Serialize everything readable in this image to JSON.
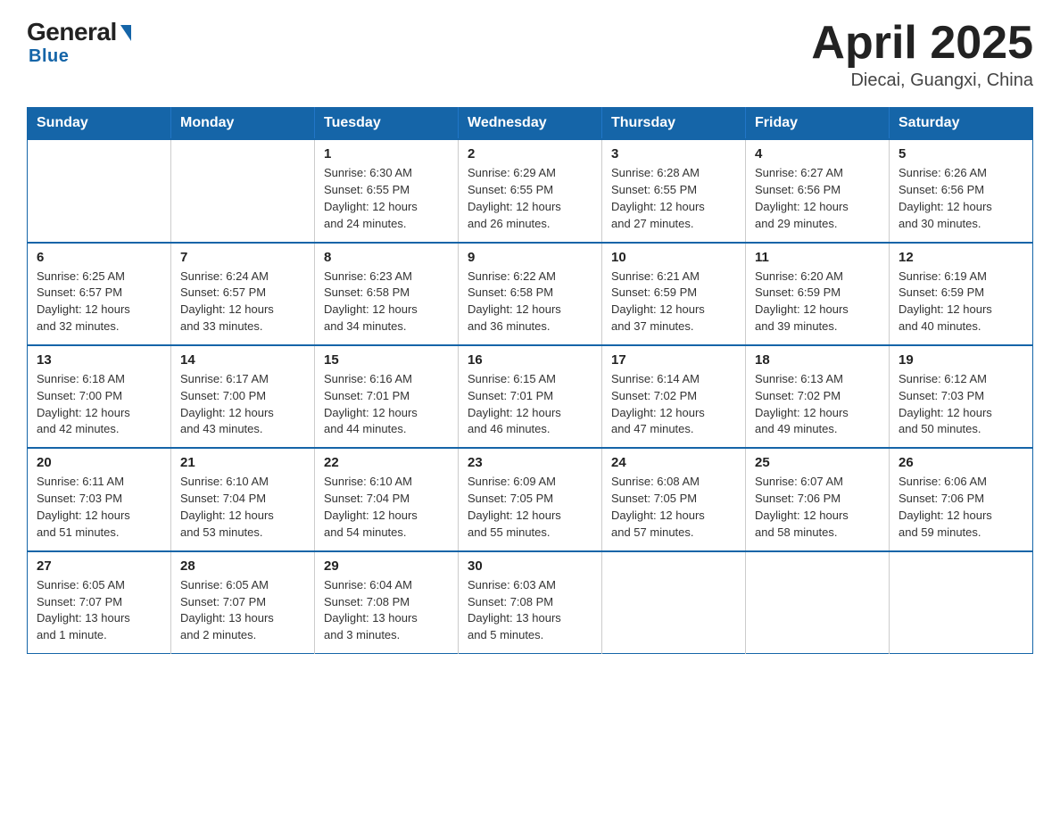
{
  "header": {
    "logo_general": "General",
    "logo_blue": "Blue",
    "title": "April 2025",
    "subtitle": "Diecai, Guangxi, China"
  },
  "calendar": {
    "days_of_week": [
      "Sunday",
      "Monday",
      "Tuesday",
      "Wednesday",
      "Thursday",
      "Friday",
      "Saturday"
    ],
    "weeks": [
      [
        {
          "day": "",
          "info": ""
        },
        {
          "day": "",
          "info": ""
        },
        {
          "day": "1",
          "info": "Sunrise: 6:30 AM\nSunset: 6:55 PM\nDaylight: 12 hours\nand 24 minutes."
        },
        {
          "day": "2",
          "info": "Sunrise: 6:29 AM\nSunset: 6:55 PM\nDaylight: 12 hours\nand 26 minutes."
        },
        {
          "day": "3",
          "info": "Sunrise: 6:28 AM\nSunset: 6:55 PM\nDaylight: 12 hours\nand 27 minutes."
        },
        {
          "day": "4",
          "info": "Sunrise: 6:27 AM\nSunset: 6:56 PM\nDaylight: 12 hours\nand 29 minutes."
        },
        {
          "day": "5",
          "info": "Sunrise: 6:26 AM\nSunset: 6:56 PM\nDaylight: 12 hours\nand 30 minutes."
        }
      ],
      [
        {
          "day": "6",
          "info": "Sunrise: 6:25 AM\nSunset: 6:57 PM\nDaylight: 12 hours\nand 32 minutes."
        },
        {
          "day": "7",
          "info": "Sunrise: 6:24 AM\nSunset: 6:57 PM\nDaylight: 12 hours\nand 33 minutes."
        },
        {
          "day": "8",
          "info": "Sunrise: 6:23 AM\nSunset: 6:58 PM\nDaylight: 12 hours\nand 34 minutes."
        },
        {
          "day": "9",
          "info": "Sunrise: 6:22 AM\nSunset: 6:58 PM\nDaylight: 12 hours\nand 36 minutes."
        },
        {
          "day": "10",
          "info": "Sunrise: 6:21 AM\nSunset: 6:59 PM\nDaylight: 12 hours\nand 37 minutes."
        },
        {
          "day": "11",
          "info": "Sunrise: 6:20 AM\nSunset: 6:59 PM\nDaylight: 12 hours\nand 39 minutes."
        },
        {
          "day": "12",
          "info": "Sunrise: 6:19 AM\nSunset: 6:59 PM\nDaylight: 12 hours\nand 40 minutes."
        }
      ],
      [
        {
          "day": "13",
          "info": "Sunrise: 6:18 AM\nSunset: 7:00 PM\nDaylight: 12 hours\nand 42 minutes."
        },
        {
          "day": "14",
          "info": "Sunrise: 6:17 AM\nSunset: 7:00 PM\nDaylight: 12 hours\nand 43 minutes."
        },
        {
          "day": "15",
          "info": "Sunrise: 6:16 AM\nSunset: 7:01 PM\nDaylight: 12 hours\nand 44 minutes."
        },
        {
          "day": "16",
          "info": "Sunrise: 6:15 AM\nSunset: 7:01 PM\nDaylight: 12 hours\nand 46 minutes."
        },
        {
          "day": "17",
          "info": "Sunrise: 6:14 AM\nSunset: 7:02 PM\nDaylight: 12 hours\nand 47 minutes."
        },
        {
          "day": "18",
          "info": "Sunrise: 6:13 AM\nSunset: 7:02 PM\nDaylight: 12 hours\nand 49 minutes."
        },
        {
          "day": "19",
          "info": "Sunrise: 6:12 AM\nSunset: 7:03 PM\nDaylight: 12 hours\nand 50 minutes."
        }
      ],
      [
        {
          "day": "20",
          "info": "Sunrise: 6:11 AM\nSunset: 7:03 PM\nDaylight: 12 hours\nand 51 minutes."
        },
        {
          "day": "21",
          "info": "Sunrise: 6:10 AM\nSunset: 7:04 PM\nDaylight: 12 hours\nand 53 minutes."
        },
        {
          "day": "22",
          "info": "Sunrise: 6:10 AM\nSunset: 7:04 PM\nDaylight: 12 hours\nand 54 minutes."
        },
        {
          "day": "23",
          "info": "Sunrise: 6:09 AM\nSunset: 7:05 PM\nDaylight: 12 hours\nand 55 minutes."
        },
        {
          "day": "24",
          "info": "Sunrise: 6:08 AM\nSunset: 7:05 PM\nDaylight: 12 hours\nand 57 minutes."
        },
        {
          "day": "25",
          "info": "Sunrise: 6:07 AM\nSunset: 7:06 PM\nDaylight: 12 hours\nand 58 minutes."
        },
        {
          "day": "26",
          "info": "Sunrise: 6:06 AM\nSunset: 7:06 PM\nDaylight: 12 hours\nand 59 minutes."
        }
      ],
      [
        {
          "day": "27",
          "info": "Sunrise: 6:05 AM\nSunset: 7:07 PM\nDaylight: 13 hours\nand 1 minute."
        },
        {
          "day": "28",
          "info": "Sunrise: 6:05 AM\nSunset: 7:07 PM\nDaylight: 13 hours\nand 2 minutes."
        },
        {
          "day": "29",
          "info": "Sunrise: 6:04 AM\nSunset: 7:08 PM\nDaylight: 13 hours\nand 3 minutes."
        },
        {
          "day": "30",
          "info": "Sunrise: 6:03 AM\nSunset: 7:08 PM\nDaylight: 13 hours\nand 5 minutes."
        },
        {
          "day": "",
          "info": ""
        },
        {
          "day": "",
          "info": ""
        },
        {
          "day": "",
          "info": ""
        }
      ]
    ]
  }
}
